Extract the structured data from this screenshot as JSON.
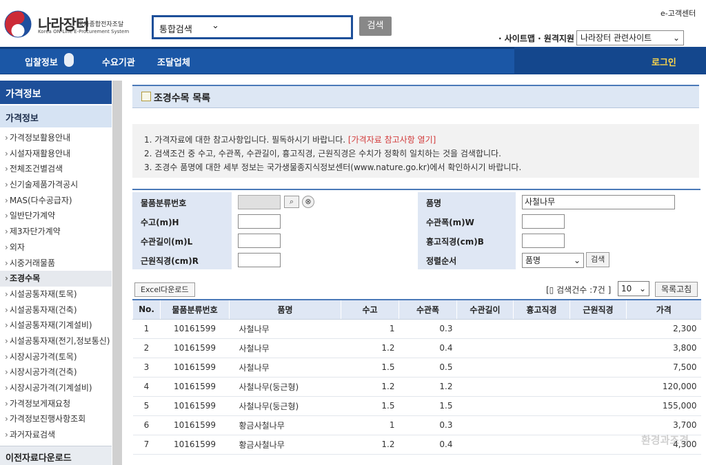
{
  "header": {
    "logo_main": "나라장터",
    "logo_small": "국가종합전자조달",
    "logo_sub": "Korea ON-Line E-Procurement System",
    "search_scope": "통합검색",
    "search_button": "검색",
    "customer_center": "e-고객센터",
    "util_links": "· 사이트맵 · 원격지원",
    "site_select": "나라장터 관련사이트"
  },
  "nav": {
    "items": [
      "입찰정보",
      "수요기관",
      "조달업체"
    ],
    "login": "로그인"
  },
  "sidebar": {
    "heading": "가격정보",
    "subheading": "가격정보",
    "items": [
      "가격정보활용안내",
      "시설자재활용안내",
      "전체조건별검색",
      "신기술제품가격공시",
      "MAS(다수공급자)",
      "일반단가계약",
      "제3자단가계약",
      "외자",
      "시중거래물품",
      "조경수목",
      "시설공통자재(토목)",
      "시설공통자재(건축)",
      "시설공통자재(기계설비)",
      "시설공통자재(전기,정보통신)",
      "시장시공가격(토목)",
      "시장시공가격(건축)",
      "시장시공가격(기계설비)",
      "가격정보게재요청",
      "가격정보진행사항조회",
      "과거자료검색"
    ],
    "active_index": 9,
    "bottom": "이전자료다운로드"
  },
  "page": {
    "title": "조경수목 목록",
    "notice": {
      "line1": "1. 가격자료에 대한 참고사항입니다. 필독하시기 바랍니다.",
      "line1_link": "[가격자료 참고사항 열기]",
      "line2": "2. 검색조건 중 수고, 수관폭, 수관길이, 흉고직경, 근원직경은 수치가 정확히 일치하는 것을 검색합니다.",
      "line3": "3. 조경수 품명에 대한 세부 정보는 국가생물종지식정보센터(www.nature.go.kr)에서 확인하시기 바랍니다."
    }
  },
  "search_form": {
    "label_class_no": "물품분류번호",
    "label_item_name": "품명",
    "item_name_value": "사철나무",
    "label_height": "수고(m)H",
    "label_crown_width": "수관폭(m)W",
    "label_crown_length": "수관길이(m)L",
    "label_dbh": "흉고직경(cm)B",
    "label_root_diameter": "근원직경(cm)R",
    "label_sort": "정렬순서",
    "sort_value": "품명",
    "search_button": "검색",
    "search_icon": "search-icon",
    "clear_icon": "clear-icon"
  },
  "toolbar": {
    "excel_button": "Excel다운로드",
    "result_count": "검색건수 :7건",
    "page_size": "10",
    "refresh_button": "목록고침"
  },
  "table": {
    "headers": [
      "No.",
      "물품분류번호",
      "품명",
      "수고",
      "수관폭",
      "수관길이",
      "흉고직경",
      "근원직경",
      "가격"
    ],
    "rows": [
      [
        "1",
        "10161599",
        "사철나무",
        "1",
        "0.3",
        "",
        "",
        "",
        "2,300"
      ],
      [
        "2",
        "10161599",
        "사철나무",
        "1.2",
        "0.4",
        "",
        "",
        "",
        "3,800"
      ],
      [
        "3",
        "10161599",
        "사철나무",
        "1.5",
        "0.5",
        "",
        "",
        "",
        "7,500"
      ],
      [
        "4",
        "10161599",
        "사철나무(둥근형)",
        "1.2",
        "1.2",
        "",
        "",
        "",
        "120,000"
      ],
      [
        "5",
        "10161599",
        "사철나무(둥근형)",
        "1.5",
        "1.5",
        "",
        "",
        "",
        "155,000"
      ],
      [
        "6",
        "10161599",
        "황금사철나무",
        "1",
        "0.3",
        "",
        "",
        "",
        "3,700"
      ],
      [
        "7",
        "10161599",
        "황금사철나무",
        "1.2",
        "0.4",
        "",
        "",
        "",
        "4,300"
      ]
    ]
  },
  "watermark": "환경과조경",
  "colors": {
    "brand_blue": "#1b57a6",
    "dark_blue": "#1d4f99",
    "header_bg": "#dfe7f4",
    "link": "#2f67b0",
    "notice_red": "#d23a3a",
    "login_yellow": "#ffd84a"
  }
}
